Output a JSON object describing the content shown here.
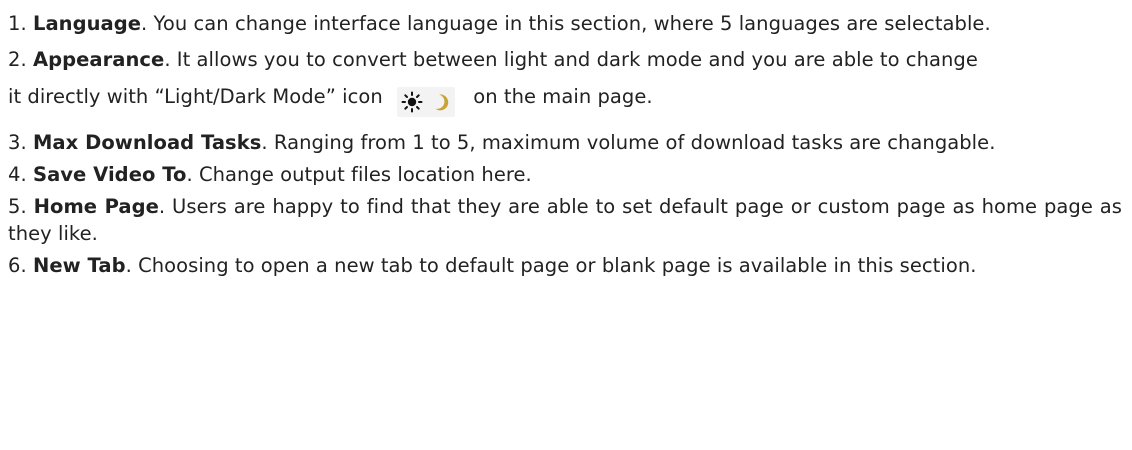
{
  "items": [
    {
      "num": "1.",
      "term": "Language",
      "text": ". You can change interface language in this section, where 5 languages are selectable."
    },
    {
      "num": "2.",
      "term": "Appearance",
      "text_a": ". It allows you to convert between light and dark mode and you are able to change",
      "text_b": "it directly with “Light/Dark Mode” icon",
      "text_c": "on the main page.",
      "icons": [
        "sun-icon",
        "moon-icon"
      ]
    },
    {
      "num": "3.",
      "term": "Max Download Tasks",
      "text": ". Ranging from 1 to 5, maximum volume of download tasks are changable."
    },
    {
      "num": "4.",
      "term": "Save Video To",
      "text": ". Change output files location here."
    },
    {
      "num": "5.",
      "term": "Home Page",
      "text": ". Users are happy to find that they are able to set default page or custom page as home page as they like."
    },
    {
      "num": "6.",
      "term": "New Tab",
      "text": ". Choosing to open a new tab to default page or blank page is available in this section."
    }
  ],
  "colors": {
    "text": "#222222",
    "sun": "#111111",
    "moon": "#c9a23a",
    "icon_bg": "#f3f3f3"
  }
}
